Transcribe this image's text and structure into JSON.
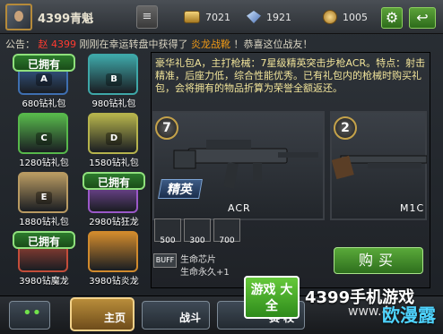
{
  "topbar": {
    "player_name": "4399青魁",
    "coins": "7021",
    "gems": "1921",
    "medals": "1005"
  },
  "announcement": {
    "prefix": "公告：",
    "highlight1": "赵",
    "highlight2": "4399",
    "middle": "刚刚在幸运转盘中获得了",
    "item": "炎龙战靴",
    "suffix": "！恭喜这位战友！"
  },
  "chests": [
    {
      "label": "680钻礼包",
      "letter": "A",
      "owned": "已拥有",
      "color": "#3e6fb0"
    },
    {
      "label": "980钻礼包",
      "letter": "B",
      "owned": "",
      "color": "#3ea7a8"
    },
    {
      "label": "1280钻礼包",
      "letter": "C",
      "owned": "",
      "color": "#57b84b"
    },
    {
      "label": "1580钻礼包",
      "letter": "D",
      "owned": "",
      "color": "#b5b34c"
    },
    {
      "label": "1880钻礼包",
      "letter": "E",
      "owned": "",
      "color": "#b89a62"
    },
    {
      "label": "2980钻狂龙",
      "letter": "",
      "owned": "已拥有",
      "color": "#9b58c9"
    },
    {
      "label": "3980钻魔龙",
      "letter": "",
      "owned": "已拥有",
      "color": "#c34d3a"
    },
    {
      "label": "3980钻炎龙",
      "letter": "",
      "owned": "",
      "color": "#d08a2d"
    }
  ],
  "package": {
    "description": "豪华礼包A，主打枪械：7星级精英突击步枪ACR。特点：射击精准，后座力低，综合性能优秀。已有礼包内的枪械时购买礼包，会将拥有的物品折算为荣誉全额返还。",
    "card1_level": "7",
    "card1_badge": "精英",
    "card1_name": "ACR",
    "card2_level": "2",
    "card2_name": "M1C",
    "items": [
      "500",
      "300",
      "700"
    ],
    "buff_label": "BUFF",
    "buff_line1": "生命芯片",
    "buff_line2": "生命永久+1",
    "buy_label": "购买"
  },
  "nav": {
    "home": "主页",
    "battle": "战斗",
    "extra": "赛 校"
  },
  "watermark": {
    "logo": "游戏\n大全",
    "text": "4399手机游戏",
    "sub": "www.4",
    "brand": "欧漫露"
  }
}
